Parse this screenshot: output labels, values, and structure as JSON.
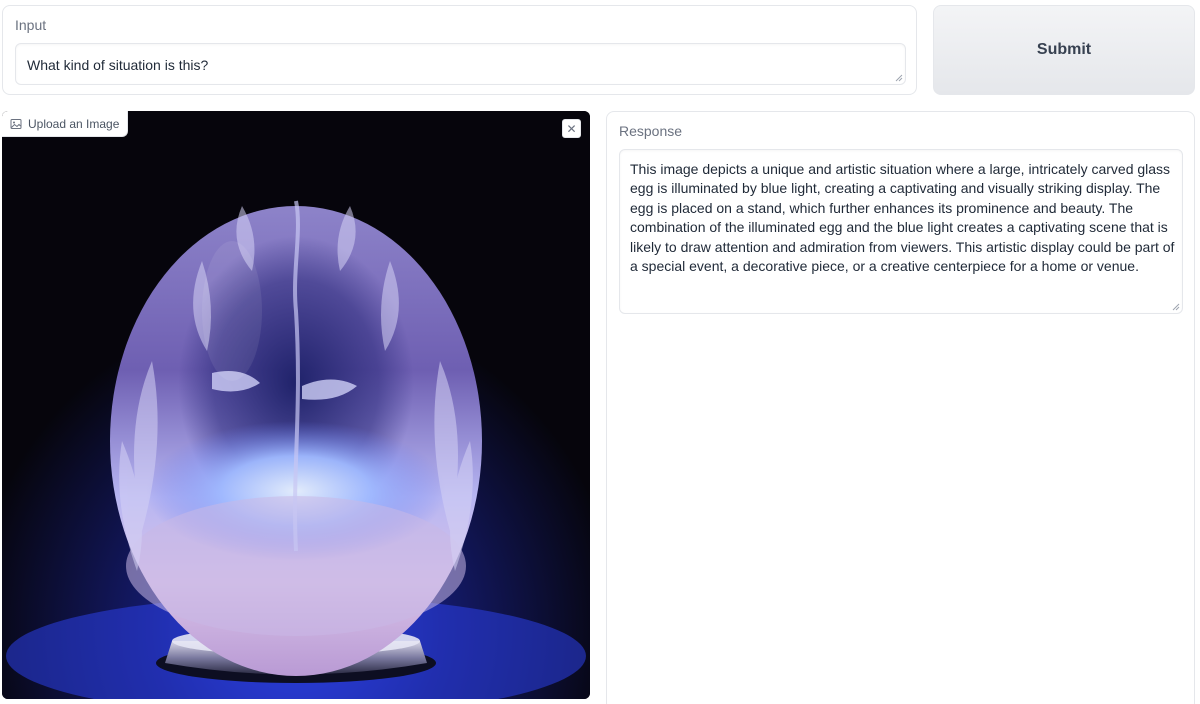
{
  "input": {
    "label": "Input",
    "value": "What kind of situation is this?"
  },
  "submit": {
    "label": "Submit"
  },
  "image_panel": {
    "upload_label": "Upload an Image",
    "clear_symbol": "✕",
    "image_subject": "glass-egg-image"
  },
  "response": {
    "label": "Response",
    "text": "This image depicts a unique and artistic situation where a large, intricately carved glass egg is illuminated by blue light, creating a captivating and visually striking display. The egg is placed on a stand, which further enhances its prominence and beauty. The combination of the illuminated egg and the blue light creates a captivating scene that is likely to draw attention and admiration from viewers. This artistic display could be part of a special event, a decorative piece, or a creative centerpiece for a home or venue."
  },
  "colors": {
    "border": "#e5e7eb",
    "button_bg": "#e5e7eb",
    "label": "#6b7280",
    "text": "#1f2937"
  }
}
